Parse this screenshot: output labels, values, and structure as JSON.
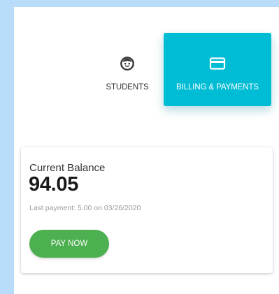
{
  "nav": {
    "tabs": [
      {
        "label": "STUDENTS",
        "icon": "child-face-icon",
        "active": false
      },
      {
        "label": "BILLING & PAYMENTS",
        "icon": "credit-card-icon",
        "active": true
      }
    ]
  },
  "balance": {
    "title": "Current Balance",
    "amount": "94.05",
    "last_payment": "Last payment: 5.00 on 03/26/2020",
    "pay_button_label": "PAY NOW"
  },
  "colors": {
    "background": "#b9dcfb",
    "active_tab": "#00bcd4",
    "pay_button": "#4caf50"
  }
}
